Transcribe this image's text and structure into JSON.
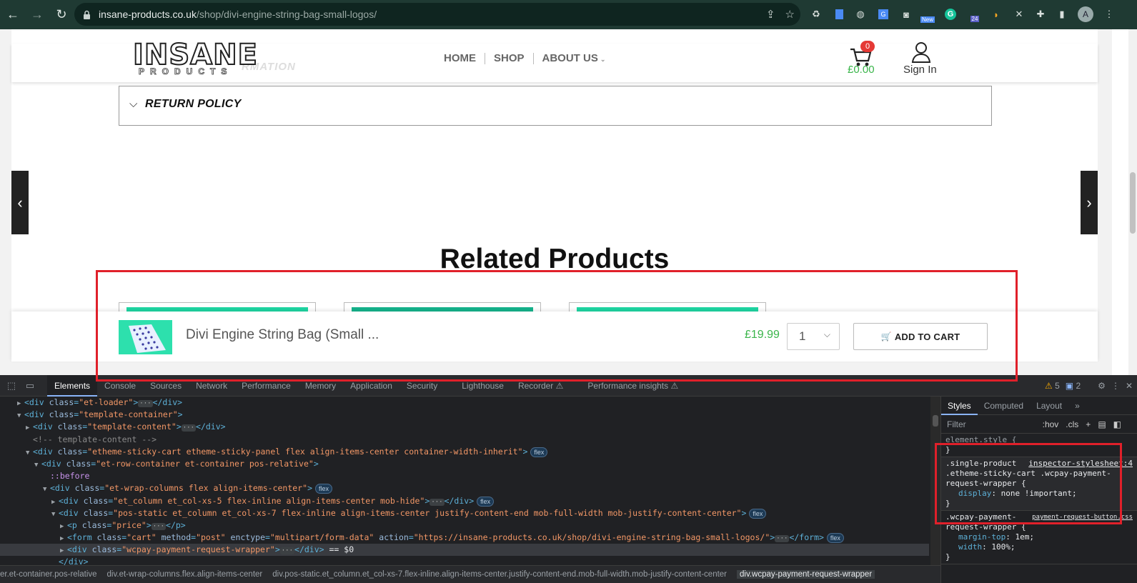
{
  "browser": {
    "url_host": "insane-products.co.uk",
    "url_path": "/shop/divi-engine-string-bag-small-logos/",
    "ext_new_label": "New",
    "ext_24_label": "24",
    "avatar_letter": "A"
  },
  "site": {
    "logo_text": "INSANE",
    "logo_sub": "PRODUCTS",
    "ghost_text": "RMATION",
    "menu": [
      {
        "label": "HOME"
      },
      {
        "label": "SHOP"
      },
      {
        "label": "ABOUT US"
      }
    ],
    "cart_count": "0",
    "cart_total": "£0.00",
    "signin_label": "Sign In",
    "accordion_title": "RETURN POLICY",
    "related_title": "Related Products"
  },
  "sticky": {
    "product_name": "Divi Engine String Bag (Small ...",
    "price": "£19.99",
    "qty": "1",
    "add_to_cart": "ADD TO CART"
  },
  "devtools": {
    "tabs": [
      "Elements",
      "Console",
      "Sources",
      "Network",
      "Performance",
      "Memory",
      "Application",
      "Security",
      "Lighthouse",
      "Recorder ⚠",
      "Performance insights ⚠"
    ],
    "warnings": "5",
    "messages": "2",
    "dom": [
      {
        "indent": 0,
        "tri": "▶",
        "html": "div_et_loader"
      },
      {
        "indent": 0,
        "tri": "▼",
        "html": "div_template_container"
      }
    ],
    "styles_tabs": [
      "Styles",
      "Computed",
      "Layout",
      "»"
    ],
    "filter_placeholder": "Filter",
    "hov": ":hov",
    "cls": ".cls",
    "element_style": "element.style {",
    "rule1_selector": ".single-product .etheme-sticky-cart .wcpay-payment-request-wrapper {",
    "rule1_source": "inspector-stylesheet:4",
    "rule1_prop": "display",
    "rule1_value": "none !important;",
    "rule2_selector": ".wcpay-payment-request-wrapper {",
    "rule2_source": "payment-request-button.css",
    "rule2_prop1": "margin-top",
    "rule2_val1": "1em;",
    "rule2_prop2": "width",
    "rule2_val2": "100%;",
    "crumbs": [
      "er.et-container.pos-relative",
      "div.et-wrap-columns.flex.align-items-center",
      "div.pos-static.et_column.et_col-xs-7.flex-inline.align-items-center.justify-content-end.mob-full-width.mob-justify-content-center",
      "div.wcpay-payment-request-wrapper"
    ]
  }
}
